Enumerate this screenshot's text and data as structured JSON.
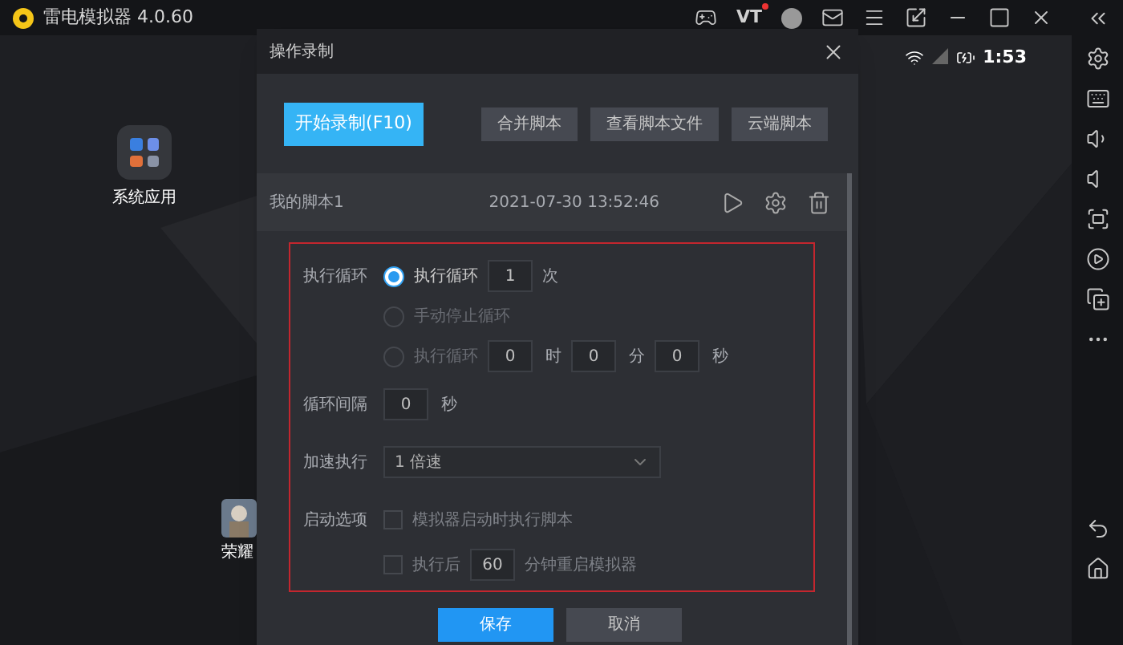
{
  "app_bar": {
    "title": "雷电模拟器 4.0.60",
    "vt_label": "VT"
  },
  "status_bar": {
    "time": "1:53"
  },
  "desktop": {
    "apps": [
      {
        "kind": "folder",
        "label": "系统应用"
      },
      {
        "kind": "game",
        "label": "荣耀"
      }
    ]
  },
  "dialog": {
    "title": "操作录制",
    "primary_button": "开始录制(F10)",
    "buttons": [
      "合并脚本",
      "查看脚本文件",
      "云端脚本"
    ],
    "script": {
      "name": "我的脚本1",
      "time": "2021-07-30 13:52:46"
    },
    "loop": {
      "label": "执行循环",
      "options": [
        {
          "kind": "count",
          "selected": true,
          "label": "执行循环",
          "value": "1",
          "unit": "次"
        },
        {
          "kind": "manual",
          "selected": false,
          "label": "手动停止循环"
        },
        {
          "kind": "duration",
          "selected": false,
          "label": "执行循环",
          "fields": [
            {
              "value": "0",
              "unit": "时"
            },
            {
              "value": "0",
              "unit": "分"
            },
            {
              "value": "0",
              "unit": "秒"
            }
          ]
        }
      ]
    },
    "interval": {
      "label": "循环间隔",
      "value": "0",
      "unit": "秒"
    },
    "speed": {
      "label": "加速执行",
      "value": "1 倍速"
    },
    "startup": {
      "label": "启动选项",
      "options": [
        {
          "kind": "autorun",
          "checked": false,
          "label": "模拟器启动时执行脚本"
        },
        {
          "kind": "restart",
          "checked": false,
          "prefix": "执行后",
          "value": "60",
          "suffix": "分钟重启模拟器"
        }
      ]
    },
    "save_button": "保存",
    "cancel_button": "取消"
  }
}
